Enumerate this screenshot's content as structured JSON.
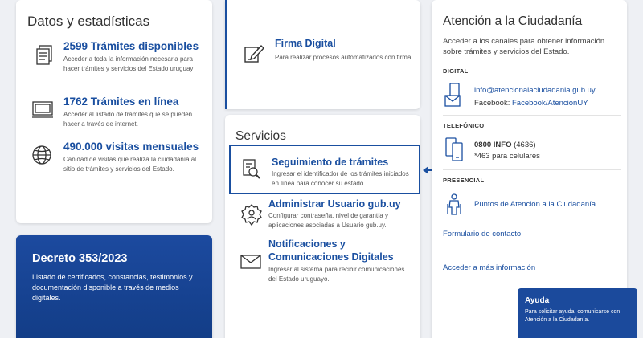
{
  "stats": {
    "title": "Datos y estadísticas",
    "items": [
      {
        "title": "2599 Trámites disponibles",
        "desc": "Acceder a toda la información necesaria para hacer trámites y servicios del Estado uruguay",
        "icon": "document-list-icon"
      },
      {
        "title": "1762 Trámites en línea",
        "desc": "Acceder al listado de trámites que se pueden hacer a través de internet.",
        "icon": "monitor-icon"
      },
      {
        "title": "490.000 visitas mensuales",
        "desc": "Canidad de visitas que realiza la ciudadanía al sitio de trámites y servicios del Estado.",
        "icon": "globe-icon"
      }
    ]
  },
  "decreto": {
    "title": "Decreto 353/2023",
    "desc": "Listado de certificados, constancias, testimonios y documentación disponible a través de medios digitales."
  },
  "firma": {
    "title": "Firma Digital",
    "desc": "Para realizar procesos automatizados con firma.",
    "icon": "signature-pen-icon"
  },
  "servicios": {
    "title": "Servicios",
    "items": [
      {
        "title": "Seguimiento de trámites",
        "desc": "Ingresar el identificador de los trámites iniciados en línea para conocer su estado.",
        "icon": "document-search-icon"
      },
      {
        "title": "Administrar Usuario gub.uy",
        "desc": "Configurar contraseña, nivel de garantía y aplicaciones asociadas a Usuario gub.uy.",
        "icon": "user-settings-icon"
      },
      {
        "title": "Notificaciones y Comunicaciones Digitales",
        "title_line1": "Notificaciones y",
        "title_line2": "Comunicaciones Digitales",
        "desc": "Ingresar al sistema para recibir comunicaciones del Estado uruguayo.",
        "icon": "envelope-icon"
      }
    ]
  },
  "atencion": {
    "title": "Atención a la Ciudadanía",
    "intro": "Acceder a los canales para obtener información sobre trámites y servicios del Estado.",
    "digital_label": "DIGITAL",
    "email": "info@atencionalaciudadania.gub.uy",
    "facebook_prefix": "Facebook: ",
    "facebook_link": "Facebook/AtencionUY",
    "telefonico_label": "TELEFÓNICO",
    "phone_bold": "0800 INFO",
    "phone_extra": " (4636)",
    "phone_cell": "*463 para celulares",
    "presencial_label": "PRESENCIAL",
    "puntos": "Puntos de Atención a la Ciudadanía",
    "formulario": "Formulario de contacto",
    "mas_info": "Acceder a más información"
  },
  "ayuda": {
    "title": "Ayuda",
    "desc": "Para solicitar ayuda, comunicarse con Atención a la Ciudadanía."
  },
  "colors": {
    "accent": "#1a4fa0",
    "banner": "#1b4a9c"
  }
}
